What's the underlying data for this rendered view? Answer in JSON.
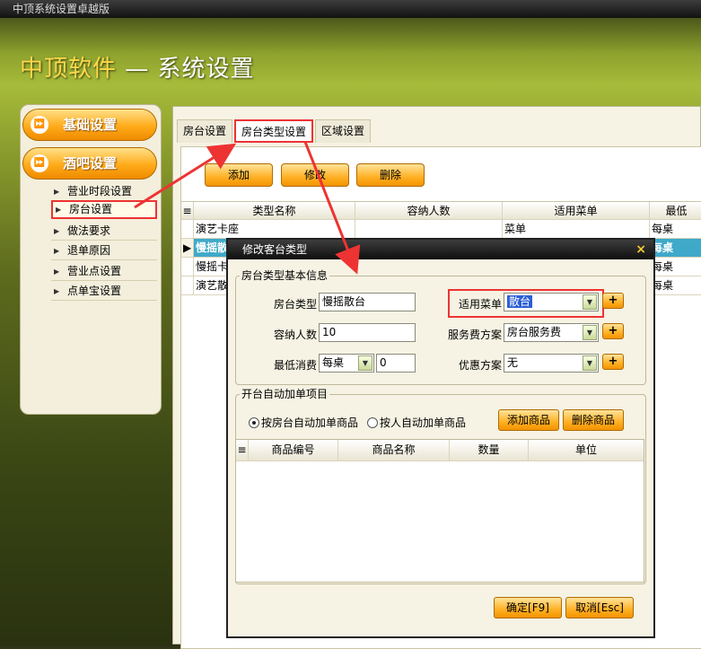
{
  "window_title": "中顶系统设置卓越版",
  "app_title": {
    "brand": "中顶软件",
    "rest": " — 系统设置"
  },
  "sidebar": {
    "categories": [
      {
        "label": "基础设置",
        "icon": "double-arrow-icon"
      },
      {
        "label": "酒吧设置",
        "icon": "double-arrow-icon"
      }
    ],
    "items": [
      {
        "label": "营业时段设置"
      },
      {
        "label": "房台设置",
        "selected": true
      },
      {
        "label": "做法要求"
      },
      {
        "label": "退单原因"
      },
      {
        "label": "营业点设置"
      },
      {
        "label": "点单宝设置"
      }
    ]
  },
  "tabs": [
    {
      "label": "房台设置"
    },
    {
      "label": "房台类型设置",
      "active": true
    },
    {
      "label": "区域设置"
    }
  ],
  "toolbar": {
    "add": "添加",
    "edit": "修改",
    "delete": "删除"
  },
  "grid": {
    "row_marker": "≡",
    "columns": [
      "类型名称",
      "容纳人数",
      "适用菜单",
      "最低"
    ],
    "rows": [
      {
        "marker": "",
        "cells": [
          "演艺卡座",
          "",
          "菜单",
          "每桌"
        ]
      },
      {
        "marker": "▶",
        "cells": [
          "慢摇散台",
          "",
          "",
          "每桌"
        ],
        "selected": true
      },
      {
        "marker": "",
        "cells": [
          "慢摇卡",
          "",
          "",
          "每桌"
        ]
      },
      {
        "marker": "",
        "cells": [
          "演艺散",
          "",
          "",
          "每桌"
        ]
      }
    ]
  },
  "dialog": {
    "title": "修改客台类型",
    "close": "×",
    "basic_group": "房台类型基本信息",
    "room_type_label": "房台类型",
    "room_type_value": "慢摇散台",
    "capacity_label": "容纳人数",
    "capacity_value": "10",
    "min_spend_label": "最低消费",
    "min_spend_unit": "每桌",
    "min_spend_value": "0",
    "menu_label": "适用菜单",
    "menu_value": "散台",
    "service_label": "服务费方案",
    "service_value": "房台服务费",
    "discount_label": "优惠方案",
    "discount_value": "无",
    "plus": "+",
    "auto_group": "开台自动加单项目",
    "radio_by_room": "按房台自动加单商品",
    "radio_by_person": "按人自动加单商品",
    "add_goods": "添加商品",
    "delete_goods": "删除商品",
    "goods_columns": [
      "商品编号",
      "商品名称",
      "数量",
      "单位"
    ],
    "confirm": "确定[F9]",
    "cancel": "取消[Esc]"
  },
  "colors": {
    "accent": "#ffab1a",
    "highlight": "#ee3333",
    "selected_row": "#3fa9c9"
  }
}
